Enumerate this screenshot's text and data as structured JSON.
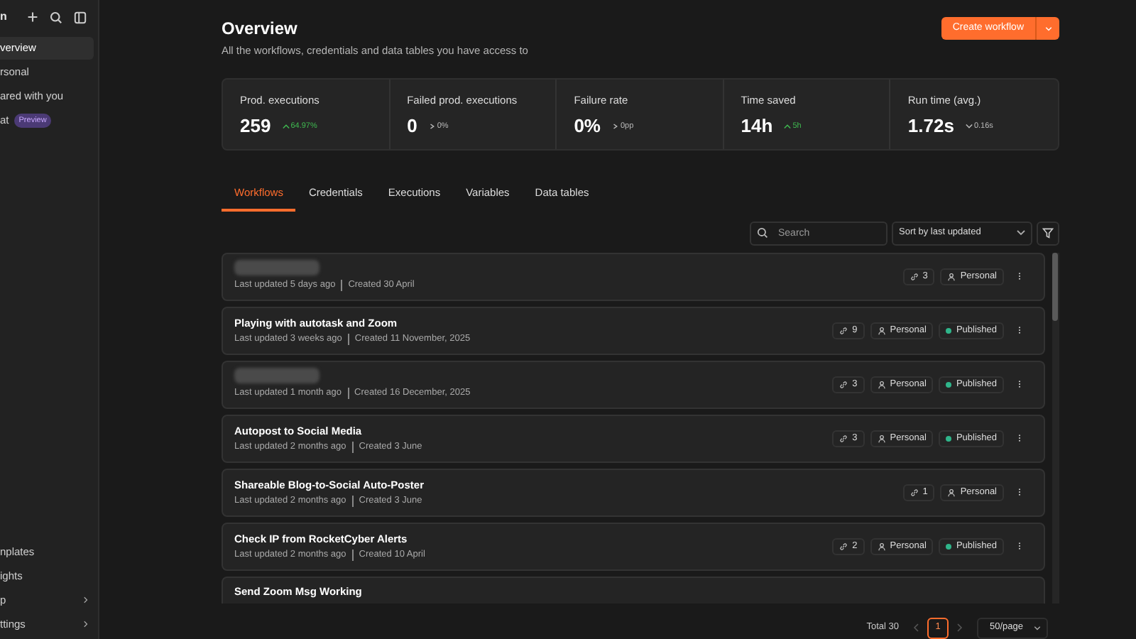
{
  "sidebar": {
    "logo": "n",
    "top_items": [
      {
        "label": "verview",
        "selected": true
      },
      {
        "label": "rsonal",
        "selected": false
      },
      {
        "label": "ared with you",
        "selected": false
      },
      {
        "label": "at",
        "badge": "Preview",
        "selected": false
      }
    ],
    "bottom_items": [
      {
        "label": "nplates",
        "has_submenu": false
      },
      {
        "label": "ights",
        "has_submenu": false
      },
      {
        "label": "p",
        "has_submenu": true
      },
      {
        "label": "ttings",
        "has_submenu": true
      }
    ]
  },
  "header": {
    "title": "Overview",
    "subtitle": "All the workflows, credentials and data tables you have access to",
    "create_button": "Create workflow"
  },
  "stats": [
    {
      "label": "Prod. executions",
      "value": "259",
      "change": "64.97%",
      "kind": "up"
    },
    {
      "label": "Failed prod. executions",
      "value": "0",
      "change": "0%",
      "kind": "flat"
    },
    {
      "label": "Failure rate",
      "value": "0%",
      "change": "0pp",
      "kind": "flat"
    },
    {
      "label": "Time saved",
      "value": "14h",
      "change": "5h",
      "kind": "up"
    },
    {
      "label": "Run time (avg.)",
      "value": "1.72s",
      "change": "0.16s",
      "kind": "down"
    }
  ],
  "tabs": [
    {
      "label": "Workflows",
      "selected": true
    },
    {
      "label": "Credentials",
      "selected": false
    },
    {
      "label": "Executions",
      "selected": false
    },
    {
      "label": "Variables",
      "selected": false
    },
    {
      "label": "Data tables",
      "selected": false
    }
  ],
  "search": {
    "placeholder": "Search"
  },
  "sort": {
    "value": "Sort by last updated"
  },
  "workflows": [
    {
      "title_hidden": true,
      "updated": "Last updated 5 days ago",
      "created": "Created 30 April",
      "links": "3",
      "owner": "Personal"
    },
    {
      "title": "Playing with autotask and Zoom",
      "updated": "Last updated 3 weeks ago",
      "created": "Created 11 November, 2025",
      "links": "9",
      "owner": "Personal",
      "status": "Published"
    },
    {
      "title_hidden": true,
      "updated": "Last updated 1 month ago",
      "created": "Created 16 December, 2025",
      "links": "3",
      "owner": "Personal",
      "status": "Published"
    },
    {
      "title": "Autopost to Social Media",
      "updated": "Last updated 2 months ago",
      "created": "Created 3 June",
      "links": "3",
      "owner": "Personal",
      "status": "Published"
    },
    {
      "title": "Shareable Blog-to-Social Auto-Poster",
      "updated": "Last updated 2 months ago",
      "created": "Created 3 June",
      "links": "1",
      "owner": "Personal"
    },
    {
      "title": "Check IP from RocketCyber Alerts",
      "updated": "Last updated 2 months ago",
      "created": "Created 10 April",
      "links": "2",
      "owner": "Personal",
      "status": "Published"
    },
    {
      "title": "Send Zoom Msg Working"
    }
  ],
  "pagination": {
    "total": "Total 30",
    "pages": [
      {
        "label": "1",
        "selected": true
      }
    ],
    "page_size": "50/page"
  }
}
